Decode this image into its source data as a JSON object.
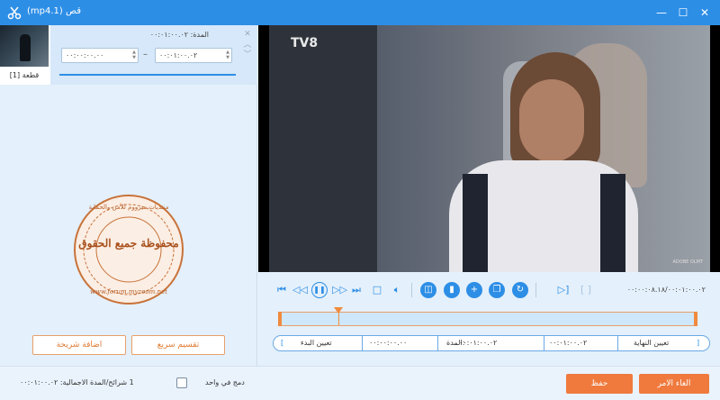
{
  "window": {
    "title": "قص (mp4.1)",
    "minimize": "—",
    "maximize": "☐",
    "close": "✕"
  },
  "clip": {
    "index_label": "قطعة [1]",
    "duration": "المدة: ٠٠:٠١:٠٠.٠٢",
    "start_time": "٠٠:٠٠:٠٠.٠٠",
    "end_time": "٠٠:٠١:٠٠.٠٢"
  },
  "watermark": {
    "top_text": "منتديات ميزووم للأمن والحماية",
    "center_text": "محفوظة جميع الحقوق",
    "bottom_text": "www.forum.myzoom.net"
  },
  "left_buttons": {
    "split": "تقسيم سريع",
    "add_segment": "اضافة شريحة"
  },
  "player": {
    "channel_logo": "TV8",
    "live_tag": "ADOBE OLMT",
    "time_readout": "٠٠:٠٠:٠٨.١٨/٠٠:٠١:٠٠.٠٢",
    "progress_fraction": 0.143
  },
  "range_bar": {
    "set_start": "تعيين البدء",
    "start_value": "٠٠:٠٠:٠٠.٠٠",
    "duration_value": "٠٠:٠١:٠٠.٠٢",
    "duration_label": "المدة:",
    "end_value": "٠٠:٠١:٠٠.٠٢",
    "set_end": "تعيين النهاية"
  },
  "footer": {
    "info": "1 شرائح/المدة الاجمالية: ٠٠:٠١:٠٠.٠٢",
    "merge_label": "دمج في واحد",
    "save": "حفظ",
    "cancel": "الغاء الامر"
  },
  "colors": {
    "accent": "#2d8ee6",
    "orange": "#f07a3e"
  }
}
